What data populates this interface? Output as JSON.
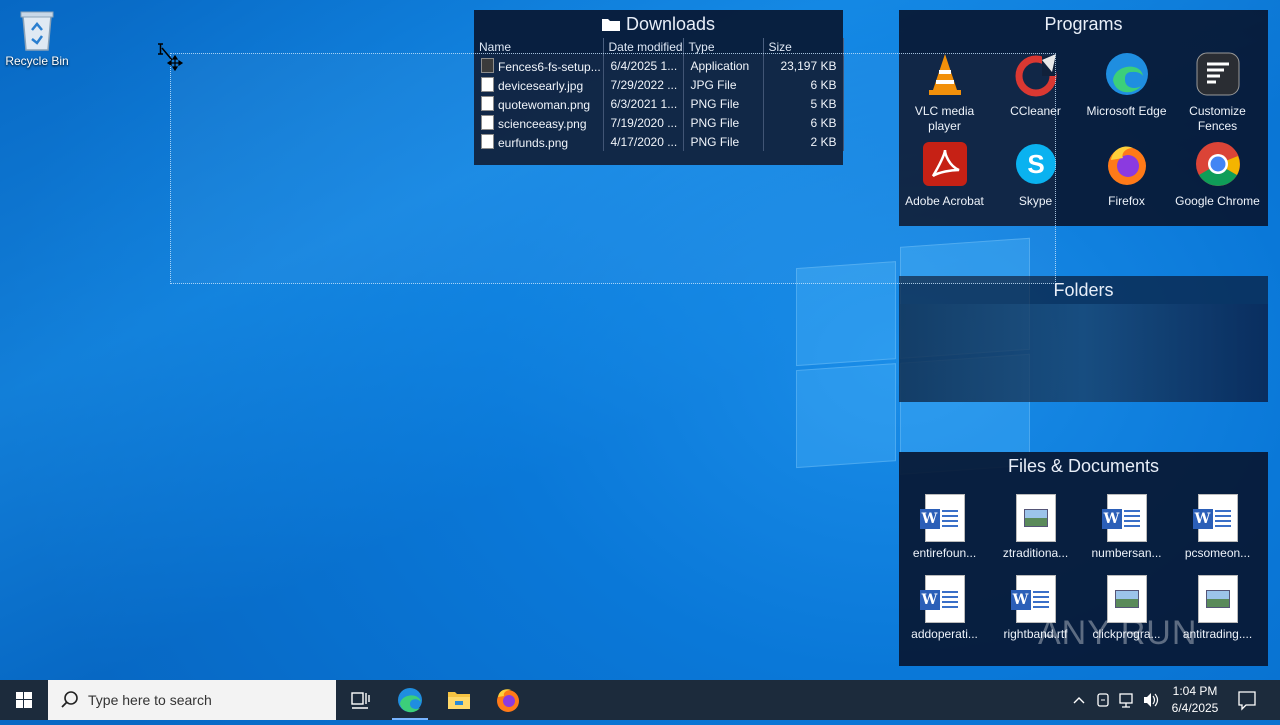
{
  "desktop": {
    "recycle_bin_label": "Recycle Bin"
  },
  "downloads_fence": {
    "title": "Downloads",
    "columns": [
      "Name",
      "Date modified",
      "Type",
      "Size"
    ],
    "rows": [
      {
        "name": "Fences6-fs-setup...",
        "date": "6/4/2025 1...",
        "type": "Application",
        "size": "23,197 KB",
        "icon": "application-icon"
      },
      {
        "name": "devicesearly.jpg",
        "date": "7/29/2022 ...",
        "type": "JPG File",
        "size": "6 KB",
        "icon": "image-file-icon"
      },
      {
        "name": "quotewoman.png",
        "date": "6/3/2021 1...",
        "type": "PNG File",
        "size": "5 KB",
        "icon": "image-file-icon"
      },
      {
        "name": "scienceeasy.png",
        "date": "7/19/2020 ...",
        "type": "PNG File",
        "size": "6 KB",
        "icon": "image-file-icon"
      },
      {
        "name": "eurfunds.png",
        "date": "4/17/2020 ...",
        "type": "PNG File",
        "size": "2 KB",
        "icon": "image-file-icon"
      }
    ]
  },
  "programs_fence": {
    "title": "Programs",
    "items": [
      {
        "label": "VLC media player",
        "icon": "vlc-icon"
      },
      {
        "label": "CCleaner",
        "icon": "ccleaner-icon"
      },
      {
        "label": "Microsoft Edge",
        "icon": "edge-icon"
      },
      {
        "label": "Customize Fences",
        "icon": "fences-icon"
      },
      {
        "label": "Adobe Acrobat",
        "icon": "acrobat-icon"
      },
      {
        "label": "Skype",
        "icon": "skype-icon"
      },
      {
        "label": "Firefox",
        "icon": "firefox-icon"
      },
      {
        "label": "Google Chrome",
        "icon": "chrome-icon"
      }
    ]
  },
  "folders_fence": {
    "title": "Folders"
  },
  "files_fence": {
    "title": "Files & Documents",
    "items": [
      {
        "label": "entirefoun...",
        "kind": "word"
      },
      {
        "label": "ztraditiona...",
        "kind": "image"
      },
      {
        "label": "numbersan...",
        "kind": "word"
      },
      {
        "label": "pcsomeon...",
        "kind": "word"
      },
      {
        "label": "addoperati...",
        "kind": "word"
      },
      {
        "label": "rightband.rtf",
        "kind": "word"
      },
      {
        "label": "clickprogra...",
        "kind": "image"
      },
      {
        "label": "antitrading....",
        "kind": "image"
      }
    ]
  },
  "taskbar": {
    "search_placeholder": "Type here to search",
    "clock_time": "1:04 PM",
    "clock_date": "6/4/2025"
  },
  "watermark": "ANY RUN"
}
